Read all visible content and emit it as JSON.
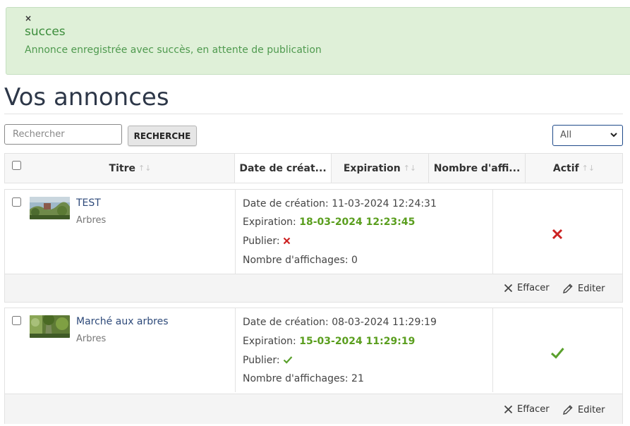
{
  "alert": {
    "close": "×",
    "title": "succes",
    "message": "Annonce enregistrée avec succès, en attente de publication"
  },
  "page": {
    "title": "Vos annonces"
  },
  "search": {
    "placeholder": "Rechercher",
    "button": "RECHERCHE"
  },
  "filter": {
    "selected": "All"
  },
  "table": {
    "columns": [
      {
        "label": "Titre",
        "sortable": true
      },
      {
        "label": "Date de créat...",
        "sortable": false
      },
      {
        "label": "Expiration",
        "sortable": true
      },
      {
        "label": "Nombre d'affi...",
        "sortable": false
      },
      {
        "label": "Actif",
        "sortable": true
      }
    ],
    "sort_glyph": "↑↓"
  },
  "rows": [
    {
      "title": "TEST",
      "category": "Arbres",
      "created_label": "Date de création:",
      "created": "11-03-2024 12:24:31",
      "expiration_label": "Expiration:",
      "expiration": "18-03-2024 12:23:45",
      "publish_label": "Publier:",
      "published": false,
      "views_label": "Nombre d'affichages:",
      "views": "0",
      "active": false
    },
    {
      "title": "Marché aux arbres",
      "category": "Arbres",
      "created_label": "Date de création:",
      "created": "08-03-2024 11:29:19",
      "expiration_label": "Expiration:",
      "expiration": "15-03-2024 11:29:19",
      "publish_label": "Publier:",
      "published": true,
      "views_label": "Nombre d'affichages:",
      "views": "21",
      "active": true
    }
  ],
  "actions": {
    "delete": "Effacer",
    "edit": "Editer"
  },
  "colors": {
    "success_bg": "#dff0d8",
    "expiry_green": "#5a9e1e",
    "cross_red": "#cc2222",
    "check_green": "#5aa02c",
    "link_blue": "#2e4a7a"
  }
}
